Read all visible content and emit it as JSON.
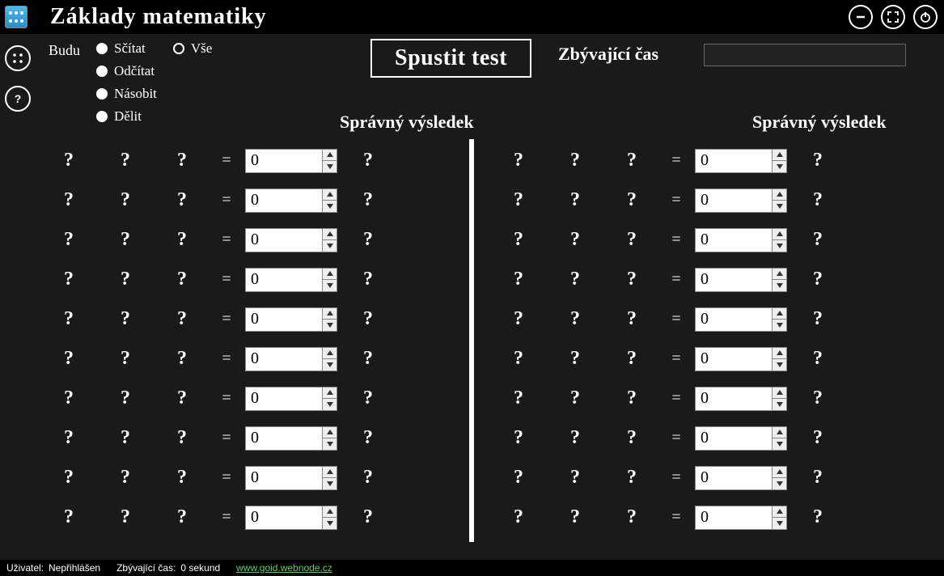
{
  "app": {
    "title": "Základy matematiky"
  },
  "controls": {
    "budu": "Budu",
    "ops": {
      "scitat": "Sčítat",
      "odcitat": "Odčítat",
      "nasobit": "Násobit",
      "delit": "Dělit",
      "vse": "Vše"
    },
    "start": "Spustit test",
    "time_label": "Zbývající čas",
    "time_value": ""
  },
  "headers": {
    "result": "Správný výsledek"
  },
  "placeholder": "?",
  "eq": "=",
  "rows_left": [
    {
      "a": "?",
      "b": "?",
      "c": "?",
      "v": "0",
      "r": "?"
    },
    {
      "a": "?",
      "b": "?",
      "c": "?",
      "v": "0",
      "r": "?"
    },
    {
      "a": "?",
      "b": "?",
      "c": "?",
      "v": "0",
      "r": "?"
    },
    {
      "a": "?",
      "b": "?",
      "c": "?",
      "v": "0",
      "r": "?"
    },
    {
      "a": "?",
      "b": "?",
      "c": "?",
      "v": "0",
      "r": "?"
    },
    {
      "a": "?",
      "b": "?",
      "c": "?",
      "v": "0",
      "r": "?"
    },
    {
      "a": "?",
      "b": "?",
      "c": "?",
      "v": "0",
      "r": "?"
    },
    {
      "a": "?",
      "b": "?",
      "c": "?",
      "v": "0",
      "r": "?"
    },
    {
      "a": "?",
      "b": "?",
      "c": "?",
      "v": "0",
      "r": "?"
    },
    {
      "a": "?",
      "b": "?",
      "c": "?",
      "v": "0",
      "r": "?"
    }
  ],
  "rows_right": [
    {
      "a": "?",
      "b": "?",
      "c": "?",
      "v": "0",
      "r": "?"
    },
    {
      "a": "?",
      "b": "?",
      "c": "?",
      "v": "0",
      "r": "?"
    },
    {
      "a": "?",
      "b": "?",
      "c": "?",
      "v": "0",
      "r": "?"
    },
    {
      "a": "?",
      "b": "?",
      "c": "?",
      "v": "0",
      "r": "?"
    },
    {
      "a": "?",
      "b": "?",
      "c": "?",
      "v": "0",
      "r": "?"
    },
    {
      "a": "?",
      "b": "?",
      "c": "?",
      "v": "0",
      "r": "?"
    },
    {
      "a": "?",
      "b": "?",
      "c": "?",
      "v": "0",
      "r": "?"
    },
    {
      "a": "?",
      "b": "?",
      "c": "?",
      "v": "0",
      "r": "?"
    },
    {
      "a": "?",
      "b": "?",
      "c": "?",
      "v": "0",
      "r": "?"
    },
    {
      "a": "?",
      "b": "?",
      "c": "?",
      "v": "0",
      "r": "?"
    }
  ],
  "status": {
    "user_label": "Uživatel:",
    "user_value": "Nepřihlášen",
    "time_label": "Zbývající čas:",
    "time_value": "0 sekund",
    "link": "www.goid.webnode.cz"
  }
}
